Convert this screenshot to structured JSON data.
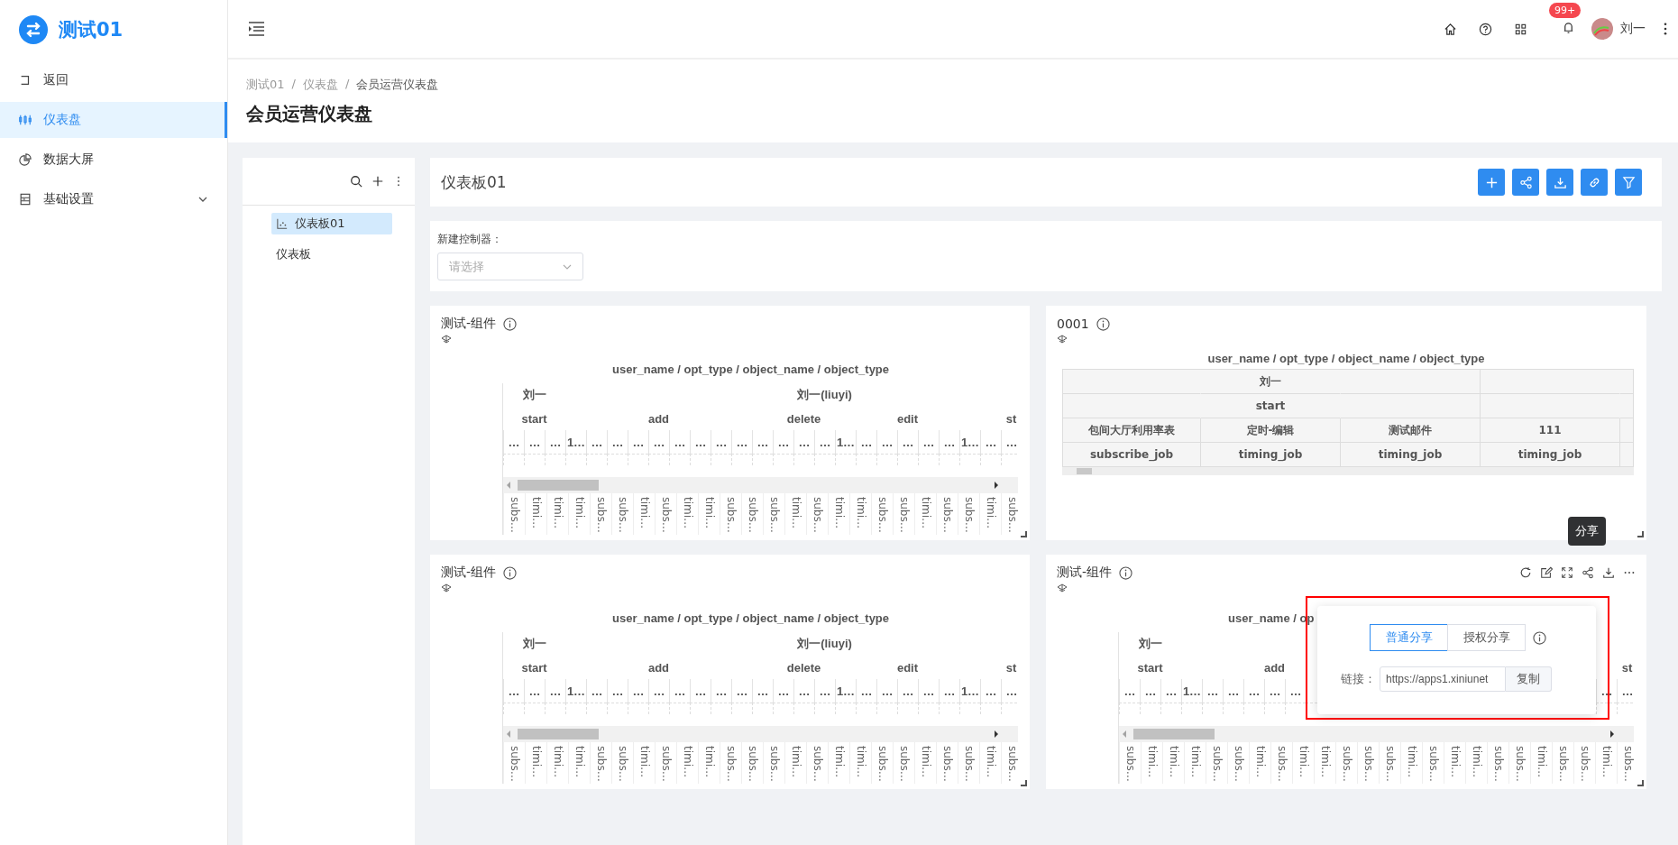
{
  "sidebar": {
    "logo_text": "测试01",
    "items": [
      {
        "label": "返回",
        "selected": false
      },
      {
        "label": "仪表盘",
        "selected": true
      },
      {
        "label": "数据大屏",
        "selected": false
      },
      {
        "label": "基础设置",
        "selected": false,
        "expanded": false
      }
    ]
  },
  "header": {
    "badge": "99+",
    "user_name": "刘一"
  },
  "breadcrumb": {
    "separator": "/",
    "items": [
      "测试01",
      "仪表盘",
      "会员运营仪表盘"
    ]
  },
  "page_title": "会员运营仪表盘",
  "tree": {
    "items": [
      {
        "label": "仪表板01",
        "kind": "dashboard",
        "selected": true
      },
      {
        "label": "仪表板",
        "kind": "folder",
        "selected": false
      }
    ]
  },
  "dashboard": {
    "title": "仪表板01"
  },
  "controller": {
    "label": "新建控制器：",
    "placeholder": "请选择"
  },
  "widgets": [
    {
      "title": "测试-组件",
      "kind": "pivot",
      "show_toolbar": false,
      "pivot": {
        "title": "user_name / opt_type / object_name / object_type",
        "rows": [
          [
            "",
            "刘一",
            "",
            "",
            "",
            "",
            "",
            "",
            "",
            "",
            "",
            "",
            "",
            "",
            "",
            "刘一(liuyi)",
            "",
            "",
            "",
            "",
            "",
            "",
            "",
            "",
            ""
          ],
          [
            "",
            "start",
            "",
            "",
            "",
            "",
            "",
            "add",
            "",
            "",
            "",
            "",
            "",
            "",
            "delete",
            "",
            "",
            "",
            "",
            "edit",
            "",
            "",
            "",
            "",
            "st"
          ],
          [
            "…",
            "…",
            "…",
            "1…",
            "…",
            "…",
            "…",
            "…",
            "…",
            "…",
            "…",
            "…",
            "…",
            "…",
            "…",
            "…",
            "1…",
            "…",
            "…",
            "…",
            "…",
            "…",
            "1…",
            "…",
            "…"
          ]
        ],
        "labels": [
          "subs…",
          "timi…",
          "timi…",
          "timi…",
          "subs…",
          "subs…",
          "timi…",
          "subs…",
          "timi…",
          "timi…",
          "subs…",
          "subs…",
          "subs…",
          "timi…",
          "subs…",
          "timi…",
          "timi…",
          "subs…",
          "subs…",
          "timi…",
          "subs…",
          "subs…",
          "timi…",
          "subs…"
        ]
      }
    },
    {
      "title": "0001",
      "kind": "table",
      "show_toolbar": false,
      "table": {
        "title": "user_name / opt_type / object_name / object_type",
        "rows": [
          [
            "",
            "刘一",
            "",
            "",
            ""
          ],
          [
            "",
            "start",
            "",
            "",
            ""
          ],
          [
            "包间大厅利用率表",
            "定时-编辑",
            "测试邮件",
            "111",
            ""
          ],
          [
            "subscribe_job",
            "timing_job",
            "timing_job",
            "timing_job",
            ""
          ]
        ]
      }
    },
    {
      "title": "测试-组件",
      "kind": "pivot",
      "show_toolbar": false,
      "pivot": {
        "title": "user_name / opt_type / object_name / object_type",
        "rows": [
          [
            "",
            "刘一",
            "",
            "",
            "",
            "",
            "",
            "",
            "",
            "",
            "",
            "",
            "",
            "",
            "",
            "刘一(liuyi)",
            "",
            "",
            "",
            "",
            "",
            "",
            "",
            "",
            ""
          ],
          [
            "",
            "start",
            "",
            "",
            "",
            "",
            "",
            "add",
            "",
            "",
            "",
            "",
            "",
            "",
            "delete",
            "",
            "",
            "",
            "",
            "edit",
            "",
            "",
            "",
            "",
            "st"
          ],
          [
            "…",
            "…",
            "…",
            "1…",
            "…",
            "…",
            "…",
            "…",
            "…",
            "…",
            "…",
            "…",
            "…",
            "…",
            "…",
            "…",
            "1…",
            "…",
            "…",
            "…",
            "…",
            "…",
            "1…",
            "…",
            "…"
          ]
        ],
        "labels": [
          "subs…",
          "timi…",
          "timi…",
          "timi…",
          "subs…",
          "subs…",
          "timi…",
          "subs…",
          "timi…",
          "timi…",
          "subs…",
          "subs…",
          "subs…",
          "timi…",
          "subs…",
          "timi…",
          "timi…",
          "subs…",
          "subs…",
          "timi…",
          "subs…",
          "subs…",
          "timi…",
          "subs…"
        ]
      }
    },
    {
      "title": "测试-组件",
      "kind": "pivot",
      "show_toolbar": true,
      "tooltip": "分享",
      "pivot": {
        "title": "user_name / op",
        "rows": [
          [
            "",
            "刘一",
            "",
            "",
            "",
            "",
            "",
            "",
            "",
            "",
            "",
            "",
            "",
            "",
            "",
            "",
            "",
            "",
            "",
            "",
            "",
            "",
            "",
            "",
            ""
          ],
          [
            "",
            "start",
            "",
            "",
            "",
            "",
            "",
            "add",
            "",
            "",
            "",
            "",
            "",
            "",
            "",
            "",
            "",
            "",
            "",
            "",
            "",
            "",
            "",
            "",
            "st"
          ],
          [
            "…",
            "…",
            "…",
            "1…",
            "…",
            "…",
            "…",
            "…",
            "…",
            "",
            "",
            "",
            "",
            "",
            "",
            "",
            "",
            "",
            "",
            "",
            "",
            "",
            "",
            "…",
            "…"
          ]
        ],
        "labels": [
          "subs…",
          "timi…",
          "timi…",
          "timi…",
          "subs…",
          "subs…",
          "timi…",
          "subs…",
          "timi…",
          "timi…",
          "subs…",
          "subs…",
          "subs…",
          "timi…",
          "subs…",
          "timi…",
          "timi…",
          "subs…",
          "subs…",
          "timi…",
          "subs…",
          "subs…",
          "timi…",
          "subs…"
        ]
      },
      "share_popup": {
        "highlighted": true,
        "tabs": [
          {
            "label": "普通分享",
            "selected": true
          },
          {
            "label": "授权分享",
            "selected": false
          }
        ],
        "link_label": "链接：",
        "link_value": "https://apps1.xiniunet",
        "copy_label": "复制"
      }
    }
  ]
}
